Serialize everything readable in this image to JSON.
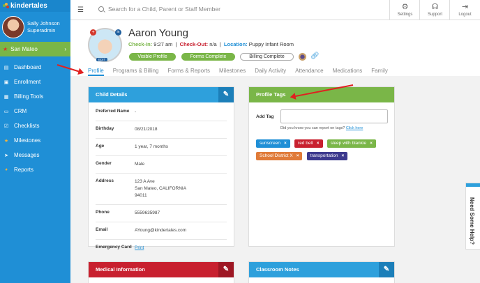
{
  "app": {
    "brand": "kindertales"
  },
  "user": {
    "name": "Sally Johnson",
    "role": "Superadmin"
  },
  "location": {
    "label": "San Mateo"
  },
  "nav": [
    {
      "label": "Dashboard",
      "icon": "dashboard-icon"
    },
    {
      "label": "Enrollment",
      "icon": "enrollment-icon"
    },
    {
      "label": "Billing Tools",
      "icon": "billing-icon"
    },
    {
      "label": "CRM",
      "icon": "crm-icon"
    },
    {
      "label": "Checklists",
      "icon": "checklist-icon"
    },
    {
      "label": "Milestones",
      "icon": "star-icon"
    },
    {
      "label": "Messages",
      "icon": "send-icon"
    },
    {
      "label": "Reports",
      "icon": "pie-icon"
    }
  ],
  "search": {
    "placeholder": "Search for a Child, Parent or Staff Member"
  },
  "topbar": {
    "settings": "Settings",
    "support": "Support",
    "logout": "Logout"
  },
  "child": {
    "name": "Aaron Young",
    "checkin_label": "Check-In:",
    "checkin_value": "9:27 am",
    "checkout_label": "Check-Out:",
    "checkout_value": "n/a",
    "location_label": "Location:",
    "location_value": "Puppy Infant Room",
    "edit_label": "EDIT"
  },
  "pills": {
    "visible": "Visible Profile",
    "forms": "Forms Complete",
    "billing": "Billing Complete"
  },
  "tabs": [
    "Profile",
    "Programs & Billing",
    "Forms & Reports",
    "Milestones",
    "Daily Activity",
    "Attendance",
    "Medications",
    "Family"
  ],
  "details": {
    "title": "Child Details",
    "rows": [
      {
        "k": "Preferred Name",
        "v": "-"
      },
      {
        "k": "Birthday",
        "v": "08/21/2018"
      },
      {
        "k": "Age",
        "v": "1 year, 7 months"
      },
      {
        "k": "Gender",
        "v": "Male"
      },
      {
        "k": "Address",
        "v1": "123 A Ave",
        "v2": "San Mateo, CALIFORNIA",
        "v3": "94011"
      },
      {
        "k": "Phone",
        "v": "5559635987"
      },
      {
        "k": "Email",
        "v": "AYoung@kindertales.com"
      },
      {
        "k": "Emergency Card",
        "v": "Print"
      }
    ]
  },
  "tags_card": {
    "title": "Profile Tags",
    "add_label": "Add Tag",
    "hint": "Did you know you can report on tags?",
    "hint_link": "Click here",
    "tags": [
      {
        "label": "sunscreen",
        "color": "#1f8fd6"
      },
      {
        "label": "red belt",
        "color": "#c8202f"
      },
      {
        "label": "sleep with blankie",
        "color": "#7ab648"
      },
      {
        "label": "School District X",
        "color": "#e07b39"
      },
      {
        "label": "transportation",
        "color": "#3d3a8e"
      }
    ]
  },
  "medical": {
    "title": "Medical Information"
  },
  "notes": {
    "title": "Classroom Notes"
  },
  "help": {
    "label": "Need Some Help?"
  }
}
